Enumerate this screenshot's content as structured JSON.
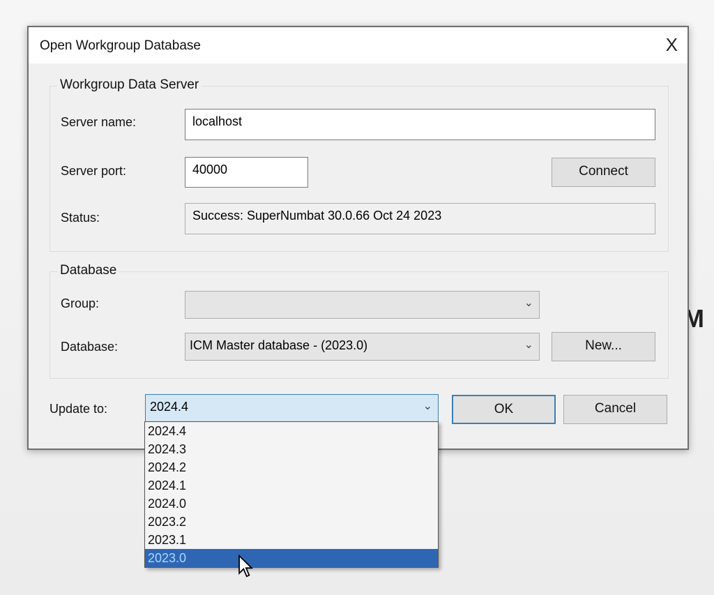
{
  "background": {
    "partial_text": "M"
  },
  "dialog": {
    "title": "Open Workgroup Database",
    "close": "X",
    "server_group": {
      "legend": "Workgroup Data Server",
      "server_name_label": "Server name:",
      "server_name": "localhost",
      "server_port_label": "Server port:",
      "server_port": "40000",
      "connect": "Connect",
      "status_label": "Status:",
      "status": "Success: SuperNumbat 30.0.66 Oct 24 2023"
    },
    "database_group": {
      "legend": "Database",
      "group_label": "Group:",
      "group_value": "",
      "database_label": "Database:",
      "database_value": "ICM Master database  - (2023.0)",
      "new": "New..."
    },
    "update_label": "Update to:",
    "update_value": "2024.4",
    "ok": "OK",
    "cancel": "Cancel",
    "update_options": [
      "2024.4",
      "2024.3",
      "2024.2",
      "2024.1",
      "2024.0",
      "2023.2",
      "2023.1",
      "2023.0"
    ],
    "highlighted_option": "2023.0"
  }
}
